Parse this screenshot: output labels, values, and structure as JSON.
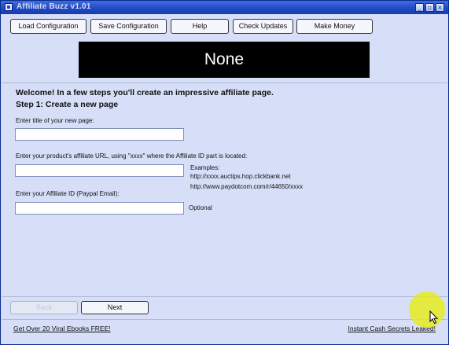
{
  "window": {
    "title": "Affiliate Buzz v1.01"
  },
  "toolbar": {
    "buttons": [
      "Load Configuration",
      "Save Configuration",
      "Help",
      "Check Updates",
      "Make Money"
    ]
  },
  "banner": {
    "text": "None"
  },
  "welcome": "Welcome! In a few steps you'll create an impressive affiliate page.",
  "step": "Step 1: Create a new page",
  "form": {
    "title_label": "Enter title of your new page:",
    "title_value": "",
    "url_label": "Enter your product's affiliate URL, using \"xxxx\" where the Affiliate ID part is located:",
    "url_value": "",
    "examples_label": "Examples:",
    "example1": "http://xxxx.auctips.hop.clickbank.net",
    "example2": "http://www.paydotcom.com/r/44650/xxxx",
    "affid_label": "Enter your Affiliate ID (Paypal Email):",
    "affid_value": "",
    "optional_label": "Optional"
  },
  "nav": {
    "back_label": "Back",
    "next_label": "Next"
  },
  "footer": {
    "left_link": "Get Over 20 Viral Ebooks FREE!",
    "right_link": "Instant Cash Secrets Leaked!"
  },
  "colors": {
    "titlebar": "#1f48c3",
    "background": "#d6dff7",
    "banner": "#000000",
    "highlight": "#e6ec1e"
  }
}
